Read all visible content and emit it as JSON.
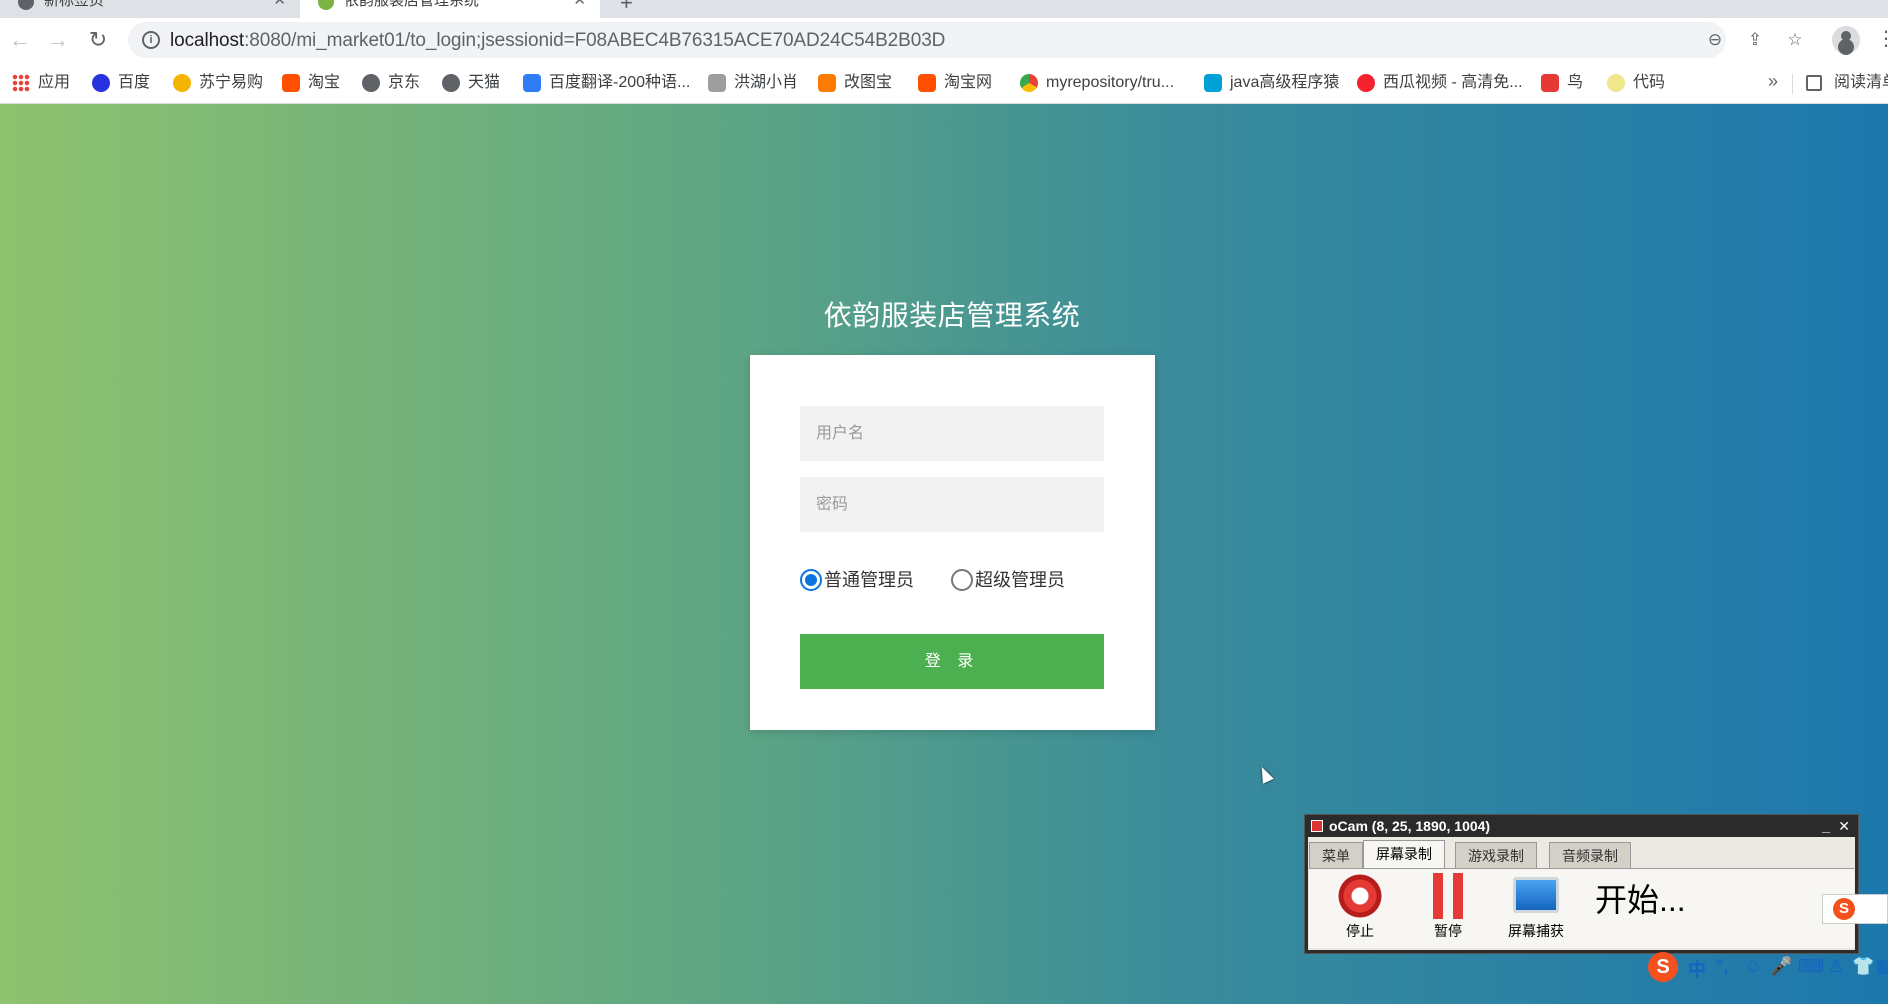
{
  "browser": {
    "tabs": [
      {
        "title": "新标签页"
      },
      {
        "title": "依韵服装店管理系统"
      }
    ],
    "url_host": "localhost",
    "url_path": ":8080/mi_market01/to_login;jsessionid=F08ABEC4B76315ACE70AD24C54B2B03D",
    "bookmarks": [
      {
        "label": "应用"
      },
      {
        "label": "百度"
      },
      {
        "label": "苏宁易购"
      },
      {
        "label": "淘宝"
      },
      {
        "label": "京东"
      },
      {
        "label": "天猫"
      },
      {
        "label": "百度翻译-200种语..."
      },
      {
        "label": "洪湖小肖"
      },
      {
        "label": "改图宝"
      },
      {
        "label": "淘宝网"
      },
      {
        "label": "myrepository/tru..."
      },
      {
        "label": "java高级程序猿"
      },
      {
        "label": "西瓜视频 - 高清免..."
      },
      {
        "label": "鸟"
      },
      {
        "label": "代码"
      }
    ],
    "more": "»",
    "reading_list": "阅读清单"
  },
  "login": {
    "title": "依韵服装店管理系统",
    "username_placeholder": "用户名",
    "password_placeholder": "密码",
    "role_normal": "普通管理员",
    "role_super": "超级管理员",
    "selected_role": "普通管理员",
    "submit": "登 录"
  },
  "ocam": {
    "title": "oCam (8, 25, 1890, 1004)",
    "tabs": [
      "菜单",
      "屏幕录制",
      "游戏录制",
      "音频录制"
    ],
    "active_tab": "屏幕录制",
    "stop": "停止",
    "pause": "暂停",
    "capture": "屏幕捕获",
    "status": "开始..."
  },
  "ime": {
    "logo": "S",
    "mode": "中",
    "punct": "°,"
  }
}
